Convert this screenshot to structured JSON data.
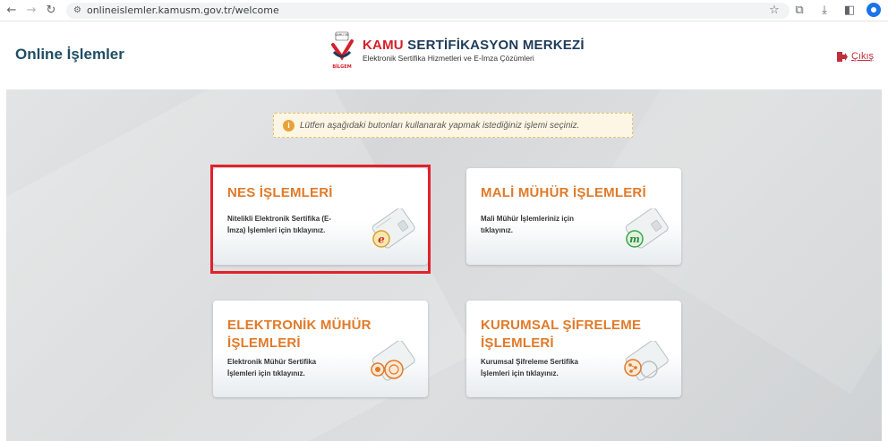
{
  "browser": {
    "url": "onlineislemler.kamusm.gov.tr/welcome"
  },
  "header": {
    "app_title": "Online İşlemler",
    "logo_small_top": "KAMU SM",
    "logo_small_bottom": "BİLGEM",
    "brand_red": "KAMU",
    "brand_dark": "SERTİFİKASYON MERKEZİ",
    "brand_sub": "Elektronik Sertifika Hizmetleri ve E-İmza Çözümleri",
    "logout_label": "Çıkış"
  },
  "main": {
    "info_message": "Lütfen aşağıdaki butonları kullanarak yapmak istediğiniz işlemi seçiniz.",
    "cards": [
      {
        "title_line1": "NES İŞLEMLERİ",
        "title_line2": "",
        "description": "Nitelikli Elektronik Sertifika (E-İmza) İşlemleri için tıklayınız.",
        "icon": "e-signature-card-icon",
        "highlighted": true
      },
      {
        "title_line1": "MALİ MÜHÜR İŞLEMLERİ",
        "title_line2": "",
        "description": "Mali Mühür İşlemleriniz için tıklayınız.",
        "icon": "fiscal-seal-card-icon",
        "highlighted": false
      },
      {
        "title_line1": "ELEKTRONİK MÜHÜR",
        "title_line2": "İŞLEMLERİ",
        "description": "Elektronik Mühür Sertifika İşlemleri için tıklayınız.",
        "icon": "electronic-seal-card-icon",
        "highlighted": false
      },
      {
        "title_line1": "KURUMSAL ŞİFRELEME",
        "title_line2": "İŞLEMLERİ",
        "description": "Kurumsal Şifreleme Sertifika İşlemleri için tıklayınız.",
        "icon": "encryption-card-icon",
        "highlighted": false
      }
    ]
  },
  "colors": {
    "card_title": "#e07a2a",
    "header_title": "#1f4e63",
    "brand_red": "#d52029",
    "highlight_border": "#e2212b",
    "info_icon": "#e8a23a"
  }
}
